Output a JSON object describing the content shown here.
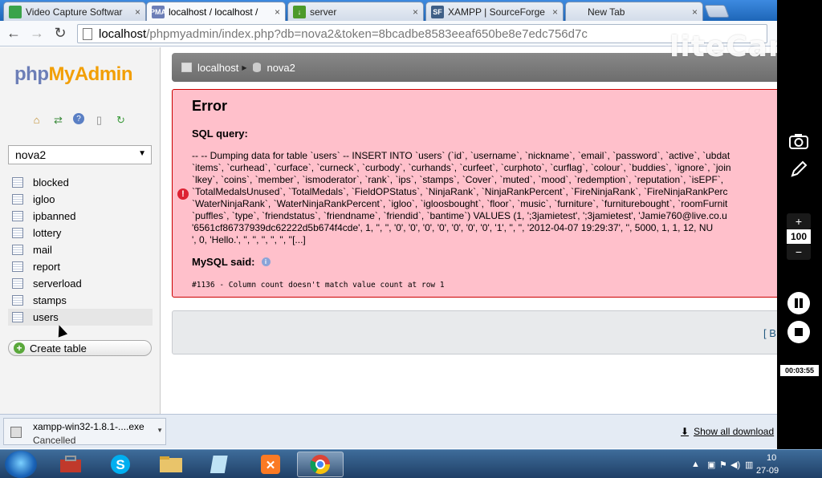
{
  "browser": {
    "tabs": [
      {
        "title": "Video Capture Softwar",
        "favicon": "page-icon",
        "color": "#3aa34a"
      },
      {
        "title": "localhost / localhost /",
        "favicon": "PMA",
        "color": "#6c7eb7"
      },
      {
        "title": "server",
        "favicon": "download-icon",
        "color": "#4c9a2a"
      },
      {
        "title": "XAMPP | SourceForge",
        "favicon": "SF",
        "color": "#3f5f86"
      },
      {
        "title": "New Tab",
        "favicon": "",
        "color": "#e9eef5"
      }
    ],
    "tab_close": "×",
    "address": {
      "host": "localhost",
      "path": "/phpmyadmin/index.php?db=nova2&token=8bcadbe8583eeaf650be8e7edc756d7c"
    }
  },
  "sidebar": {
    "logo_php": "php",
    "logo_myadmin": "MyAdmin",
    "quick_icons": [
      "home-icon",
      "refresh-icon",
      "help-icon",
      "docs-icon",
      "reload-icon"
    ],
    "database": "nova2",
    "tables": [
      "blocked",
      "igloo",
      "ipbanned",
      "lottery",
      "mail",
      "report",
      "serverload",
      "stamps",
      "users"
    ],
    "create_table": "Create table"
  },
  "main": {
    "breadcrumb": {
      "server": "localhost",
      "database": "nova2"
    },
    "error": {
      "title": "Error",
      "sql_label": "SQL query:",
      "sql_lines": [
        "-- -- Dumping data for table `users` -- INSERT INTO `users` (`id`, `username`, `nickname`, `email`, `password`, `active`, `ubdat",
        "`items`, `curhead`, `curface`, `curneck`, `curbody`, `curhands`, `curfeet`, `curphoto`, `curflag`, `colour`, `buddies`, `ignore`, `join",
        "`lkey`, `coins`, `member`, `ismoderator`, `rank`, `ips`, `stamps`, `Cover`, `muted`, `mood`, `redemption`, `reputation`, `isEPF`,",
        "`TotalMedalsUnused`, `TotalMedals`, `FieldOPStatus`, `NinjaRank`, `NinjaRankPercent`, `FireNinjaRank`, `FireNinjaRankPerc",
        "`WaterNinjaRank`, `WaterNinjaRankPercent`, `igloo`, `igloosbought`, `floor`, `music`, `furniture`, `furniturebought`, `roomFurnit",
        "`puffles`, `type`, `friendstatus`, `friendname`, `friendid`, `bantime`) VALUES (1, ';3jamietest', ';3jamietest', 'Jamie760@live.co.u",
        "'6561cf86737939dc62222d5b674f4cde', 1, '', '', '0', '0', '0', '0', '0', '0', '0', '1', '', '', '2012-04-07 19:29:37', '', 5000, 1, 1, 12, NU",
        "', 0, 'Hello.', '', '', '', '', '', ''[...]"
      ],
      "mysql_said": "MySQL said:",
      "message": "#1136 - Column count doesn't match value count at row 1"
    },
    "back_link": "[ B"
  },
  "download": {
    "filename": "xampp-win32-1.8.1-....exe",
    "status": "Cancelled",
    "show_all": "Show all download"
  },
  "watermark": "liteCam",
  "recorder": {
    "zoom_plus": "+",
    "zoom_value": "100",
    "zoom_minus": "−",
    "timer": "00:03:55"
  },
  "taskbar": {
    "clock_time": "10",
    "clock_date": "27-09"
  }
}
